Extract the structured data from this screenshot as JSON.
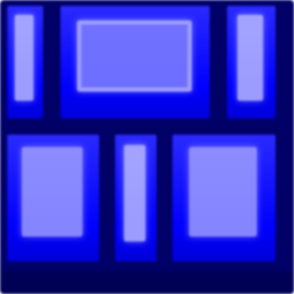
{
  "icon": {
    "name": "grid-layout-icon",
    "palette": {
      "frame": "#000066",
      "tile": "#0000ff",
      "highlight": "#aaaaff"
    }
  }
}
